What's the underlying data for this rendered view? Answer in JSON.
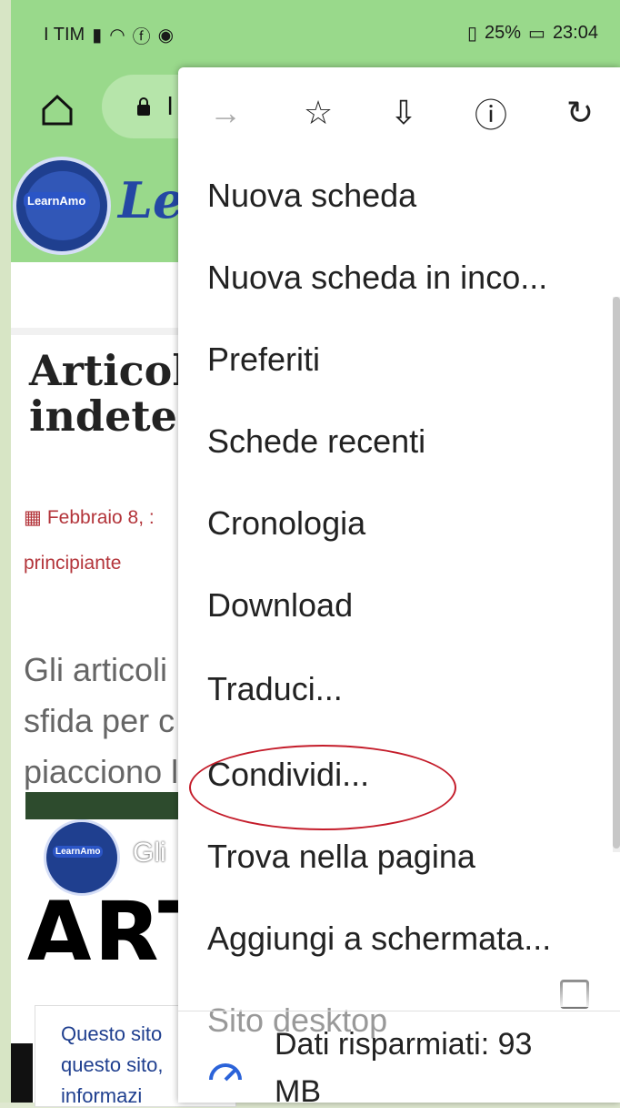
{
  "status_bar": {
    "carrier": "I TIM",
    "battery": "25%",
    "time": "23:04"
  },
  "toolbar": {
    "url_partial": "l"
  },
  "website": {
    "logo_text": "LearnAmo",
    "site_name_partial": "Le",
    "title_line1": "Articol",
    "title_line2": "indeter",
    "date_text": "Febbraio 8, :",
    "category_text": "principiante",
    "intro_line1": "Gli articoli",
    "intro_line2": "sfida per c",
    "intro_line3": "piacciono l",
    "hero_logo_text": "LearnAmo",
    "hero_subtitle": "Gli",
    "hero_main": "ART",
    "cookie_line1": "Questo sito",
    "cookie_line2": "questo sito,",
    "cookie_line3": "informazi"
  },
  "menu": {
    "items": [
      "Nuova scheda",
      "Nuova scheda in inco...",
      "Preferiti",
      "Schede recenti",
      "Cronologia",
      "Download",
      "Traduci...",
      "Condividi...",
      "Trova nella pagina",
      "Aggiungi a schermata...",
      "Sito desktop"
    ],
    "saver_line1": "Dati risparmiati: 93",
    "saver_line2": "MB"
  },
  "colors": {
    "status_green": "#99d98b",
    "highlight_red": "#c41c2a",
    "brand_blue": "#2447a4",
    "date_red": "#b3343a"
  }
}
